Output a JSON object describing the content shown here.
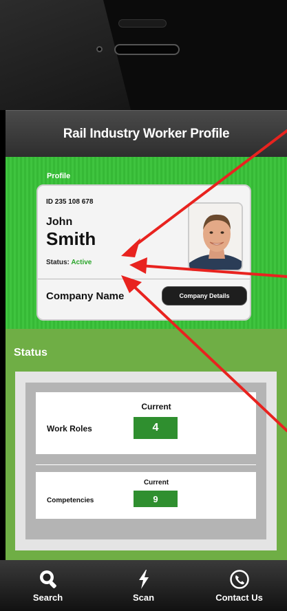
{
  "app": {
    "title": "Rail Industry Worker Profile"
  },
  "profile": {
    "section_label": "Profile",
    "id_text": "ID 235 108 678",
    "first_name": "John",
    "last_name": "Smith",
    "status_prefix": "Status:",
    "status_value": "Active",
    "company_name": "Company Name",
    "company_button": "Company Details"
  },
  "status": {
    "title": "Status",
    "work_roles": {
      "label": "Work Roles",
      "current_label": "Current",
      "count": "4"
    },
    "competencies": {
      "label": "Competencies",
      "current_label": "Current",
      "count": "9"
    }
  },
  "tabs": [
    {
      "label": "Search",
      "icon": "search-icon"
    },
    {
      "label": "Scan",
      "icon": "lightning-icon"
    },
    {
      "label": "Contact Us",
      "icon": "phone-icon"
    }
  ],
  "colors": {
    "profile_green": "#3fc43f",
    "status_green": "#6fae45",
    "count_green": "#2f8f2f",
    "active_green": "#2aa52a",
    "annotation_red": "#e8231f"
  }
}
